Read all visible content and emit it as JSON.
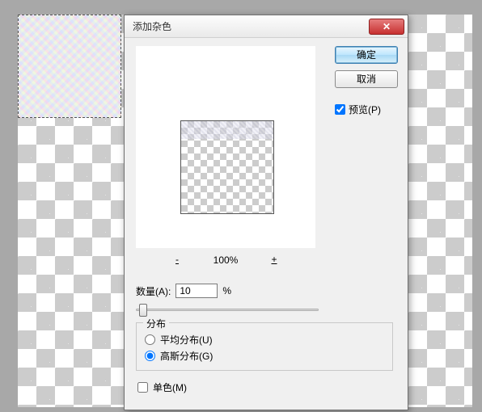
{
  "dialog": {
    "title": "添加杂色",
    "ok_label": "确定",
    "cancel_label": "取消",
    "preview_label": "预览(P)",
    "preview_checked": true,
    "zoom": {
      "minus": "-",
      "value": "100%",
      "plus": "+"
    },
    "amount": {
      "label": "数量(A):",
      "value": "10",
      "unit": "%"
    },
    "distribution": {
      "legend": "分布",
      "uniform": "平均分布(U)",
      "gaussian": "高斯分布(G)",
      "selected": "gaussian"
    },
    "monochromatic": {
      "label": "单色(M)",
      "checked": false
    }
  }
}
